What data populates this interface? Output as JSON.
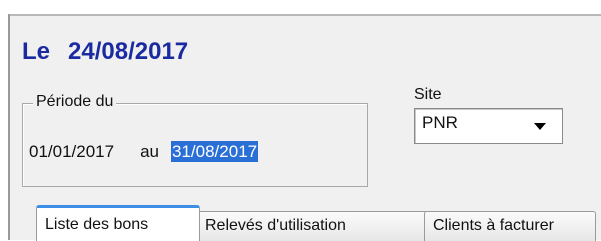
{
  "header": {
    "prefix": "Le",
    "date": "24/08/2017"
  },
  "period": {
    "legend": "Période du",
    "start": "01/01/2017",
    "separator": "au",
    "end": "31/08/2017"
  },
  "site": {
    "label": "Site",
    "selected": "PNR"
  },
  "tabs": [
    {
      "label": "Liste des bons",
      "active": true
    },
    {
      "label": "Relevés d'utilisation",
      "active": false
    },
    {
      "label": "Clients à facturer",
      "active": false
    }
  ],
  "colors": {
    "header_text": "#1a2aa0",
    "selection": "#2a6fd6",
    "active_tab_accent": "#3d8ee6"
  }
}
